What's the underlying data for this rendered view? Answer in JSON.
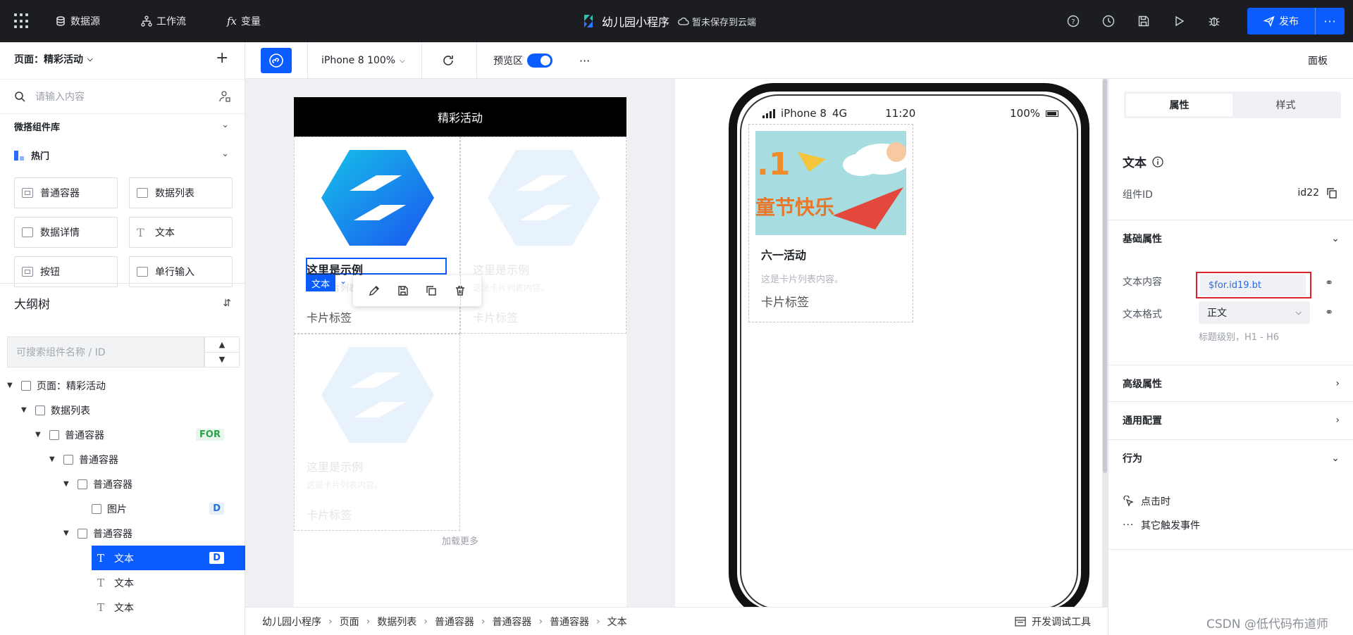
{
  "topbar": {
    "nav": [
      {
        "icon": "database-icon",
        "label": "数据源"
      },
      {
        "icon": "workflow-icon",
        "label": "工作流"
      },
      {
        "icon": "fx-icon",
        "label": "变量"
      }
    ],
    "app_title": "幼儿园小程序",
    "save_status": "暂未保存到云端",
    "icons": [
      "help-icon",
      "history-icon",
      "save-icon",
      "play-icon",
      "debug-icon"
    ],
    "publish_label": "发布",
    "more_label": "···"
  },
  "left": {
    "page_select": "页面：精彩活动",
    "search_placeholder": "请输入内容",
    "library_title": "微搭组件库",
    "hot_title": "热门",
    "components": [
      "普通容器",
      "数据列表",
      "数据详情",
      "文本",
      "按钮",
      "单行输入"
    ],
    "outline_title": "大纲树",
    "tree_search_placeholder": "可搜索组件名称 / ID",
    "tree": [
      {
        "label": "页面：精彩活动",
        "badge": ""
      },
      {
        "label": "数据列表",
        "badge": ""
      },
      {
        "label": "普通容器",
        "badge": "FOR"
      },
      {
        "label": "普通容器",
        "badge": ""
      },
      {
        "label": "普通容器",
        "badge": ""
      },
      {
        "label": "图片",
        "badge": "D"
      },
      {
        "label": "普通容器",
        "badge": ""
      },
      {
        "label": "文本",
        "badge": "D"
      },
      {
        "label": "文本",
        "badge": ""
      },
      {
        "label": "文本",
        "badge": ""
      }
    ]
  },
  "toolbar": {
    "device": "iPhone 8 100%",
    "preview_label": "预览区",
    "more": "···",
    "panel_label": "面板"
  },
  "design": {
    "header": "精彩活动",
    "card_title": "这里是示例",
    "card_desc": "这是卡片列表内容。",
    "card_tag": "卡片标签",
    "selection_chip": "文本",
    "load_more": "加载更多"
  },
  "phone": {
    "carrier": "iPhone 8",
    "network": "4G",
    "time": "11:20",
    "battery": "100%",
    "banner_text_1": ".1",
    "banner_text_2": "童节快乐",
    "card_title": "六一活动",
    "card_desc": "这是卡片列表内容。",
    "card_tag": "卡片标签"
  },
  "crumbs": {
    "items": [
      "幼儿园小程序",
      "页面",
      "数据列表",
      "普通容器",
      "普通容器",
      "普通容器",
      "文本"
    ],
    "devtool": "开发调试工具"
  },
  "right": {
    "tabs": [
      "属性",
      "样式"
    ],
    "title": "文本",
    "component_id_label": "组件ID",
    "component_id_value": "id22",
    "basic_section": "基础属性",
    "text_content_label": "文本内容",
    "text_content_value": "$for.id19.bt",
    "text_format_label": "文本格式",
    "text_format_value": "正文",
    "text_format_hint": "标题级别，H1 - H6",
    "advanced_section": "高级属性",
    "general_section": "通用配置",
    "behavior_section": "行为",
    "on_click": "点击时",
    "other_events": "其它触发事件"
  },
  "watermark": "CSDN @低代码布道师",
  "colors": {
    "accent": "#0a5cff",
    "highlight": "#d9232d",
    "topbar": "#1b1d21"
  }
}
